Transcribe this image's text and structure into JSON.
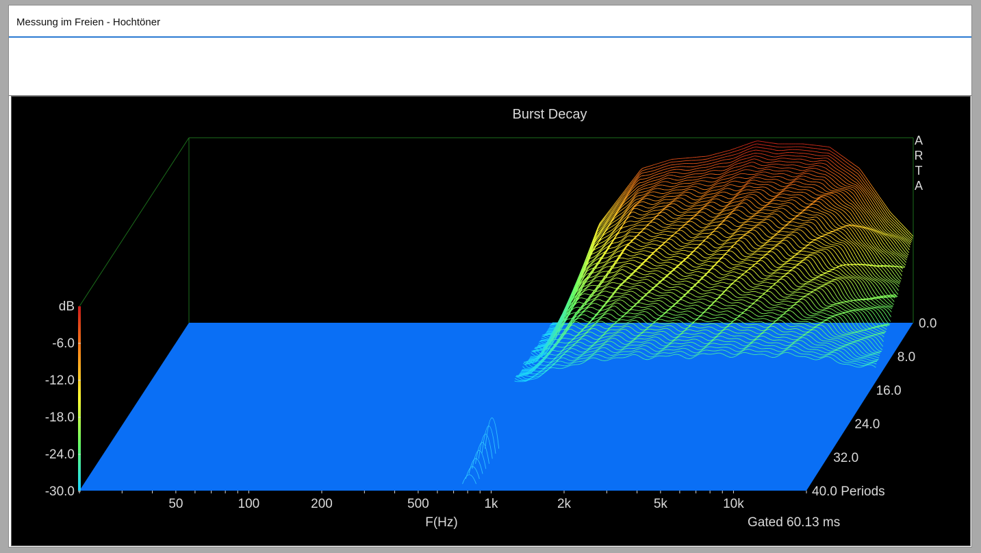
{
  "window": {
    "title": "Messung im Freien - Hochtöner"
  },
  "colors": {
    "background": "#000000",
    "floor": "#0a6ff5",
    "box_lines": "#1b6e1b",
    "text": "#d9d9d9",
    "accent": "#2a7ad2",
    "colorbar": [
      "#1ad4ff",
      "#66ff66",
      "#ffff33",
      "#ff8c1a",
      "#cc1a1a"
    ]
  },
  "chart_data": {
    "type": "waterfall",
    "title": "Burst Decay",
    "watermark": "ARTA",
    "xlabel": "F(Hz)",
    "x_scale": "log",
    "x_ticks": [
      {
        "value": 50,
        "label": "50"
      },
      {
        "value": 100,
        "label": "100"
      },
      {
        "value": 200,
        "label": "200"
      },
      {
        "value": 500,
        "label": "500"
      },
      {
        "value": 1000,
        "label": "1k"
      },
      {
        "value": 2000,
        "label": "2k"
      },
      {
        "value": 5000,
        "label": "5k"
      },
      {
        "value": 10000,
        "label": "10k"
      }
    ],
    "xlim": [
      20,
      20000
    ],
    "zlabel": "dB",
    "z_ticks": [
      "-6.0",
      "-12.0",
      "-18.0",
      "-24.0",
      "-30.0"
    ],
    "zlim": [
      -30,
      0
    ],
    "depth_ticks": [
      "0.0",
      "8.0",
      "16.0",
      "24.0",
      "32.0",
      "40.0 Periods"
    ],
    "depth_lim": [
      0,
      40
    ],
    "gated_text": "Gated 60.13 ms",
    "peak_profile": {
      "freq_hz": [
        700,
        1000,
        1500,
        2000,
        2800,
        3500,
        4500,
        5500,
        7000,
        9000,
        12000,
        16000,
        20000
      ],
      "level_db": [
        -30,
        -14,
        -5,
        -3.5,
        -3,
        -2,
        -0.5,
        -1,
        -1,
        -1.5,
        -5,
        -12,
        -16
      ]
    },
    "isolated_peaks": [
      {
        "freq_hz": 780,
        "depth": 30,
        "level_db": -25
      }
    ]
  }
}
